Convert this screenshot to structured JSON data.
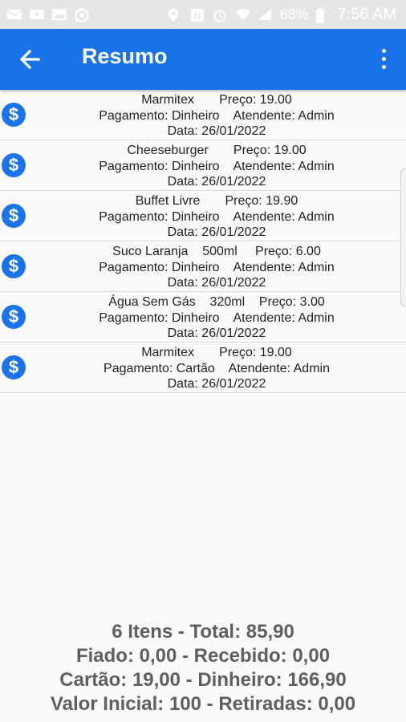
{
  "status_bar": {
    "left_icons": [
      "email-icon",
      "youtube-icon",
      "gallery-icon",
      "whatsapp-icon"
    ],
    "right_icons": [
      "location-icon",
      "nfc-icon",
      "alarm-icon",
      "wifi-icon",
      "signal-icon"
    ],
    "battery": "68%",
    "time": "7:56 AM"
  },
  "app_bar": {
    "title": "Resumo",
    "color": "#1a73e8"
  },
  "items": [
    {
      "line1": "Marmitex       Preço: 19.00",
      "line2": "Pagamento: Dinheiro    Atendente: Admin",
      "line3": "Data: 26/01/2022"
    },
    {
      "line1": "Cheeseburger       Preço: 19.00",
      "line2": "Pagamento: Dinheiro    Atendente: Admin",
      "line3": "Data: 26/01/2022"
    },
    {
      "line1": "Buffet Livre       Preço: 19.90",
      "line2": "Pagamento: Dinheiro    Atendente: Admin",
      "line3": "Data: 26/01/2022"
    },
    {
      "line1": "Suco Laranja    500ml     Preço: 6.00",
      "line2": "Pagamento: Dinheiro    Atendente: Admin",
      "line3": "Data: 26/01/2022"
    },
    {
      "line1": "Água Sem Gás    320ml    Preço: 3.00",
      "line2": "Pagamento: Dinheiro    Atendente: Admin",
      "line3": "Data: 26/01/2022"
    },
    {
      "line1": "Marmitex       Preço: 19.00",
      "line2": "Pagamento: Cartão    Atendente: Admin",
      "line3": "Data: 26/01/2022"
    }
  ],
  "summary": {
    "line1": "6 Itens - Total: 85,90",
    "line2": "Fiado: 0,00 - Recebido: 0,00",
    "line3": "Cartão: 19,00 - Dinheiro: 166,90",
    "line4": "Valor Inicial: 100 - Retiradas: 0,00"
  }
}
